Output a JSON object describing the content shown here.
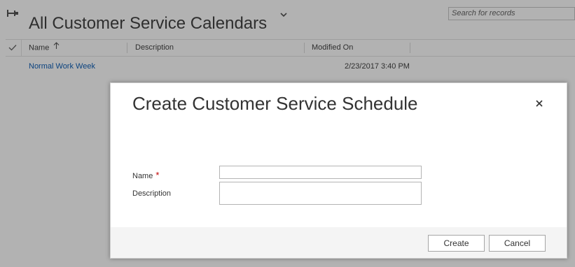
{
  "view": {
    "title": "All Customer Service Calendars",
    "chevron_icon": "chevron-down-icon",
    "pin_icon": "pin-icon"
  },
  "search": {
    "placeholder": "Search for records"
  },
  "grid": {
    "columns": [
      "Name",
      "Description",
      "Modified On"
    ],
    "sort_icon": "arrow-up-icon",
    "rows": [
      {
        "name": "Normal Work Week",
        "description": "",
        "modified_on": "2/23/2017 3:40 PM"
      }
    ]
  },
  "dialog": {
    "title": "Create Customer Service Schedule",
    "close_icon": "close-icon",
    "fields": {
      "name_label": "Name",
      "required_marker": "*",
      "name_value": "",
      "description_label": "Description",
      "description_value": ""
    },
    "buttons": {
      "create": "Create",
      "cancel": "Cancel"
    }
  },
  "colors": {
    "link": "#1160b7",
    "required": "#c00000",
    "overlay": "rgba(0,0,0,0.30)",
    "footer_bg": "#f4f4f4"
  }
}
